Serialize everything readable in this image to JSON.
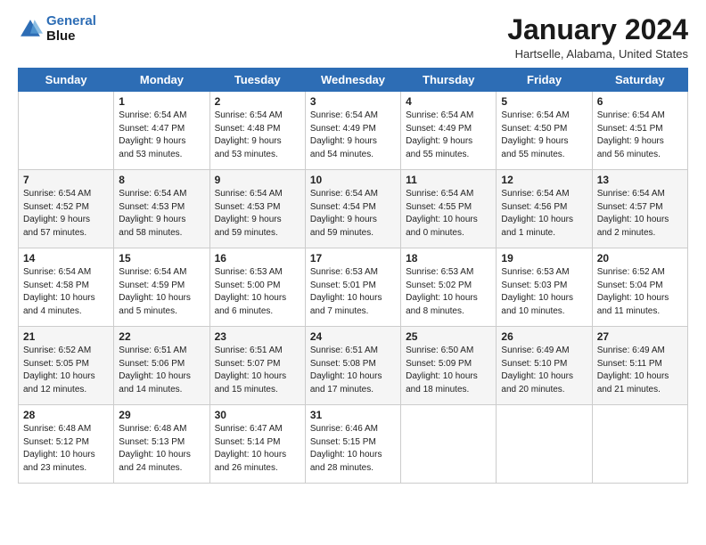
{
  "logo": {
    "line1": "General",
    "line2": "Blue"
  },
  "title": "January 2024",
  "location": "Hartselle, Alabama, United States",
  "headers": [
    "Sunday",
    "Monday",
    "Tuesday",
    "Wednesday",
    "Thursday",
    "Friday",
    "Saturday"
  ],
  "weeks": [
    [
      {
        "day": "",
        "info": ""
      },
      {
        "day": "1",
        "info": "Sunrise: 6:54 AM\nSunset: 4:47 PM\nDaylight: 9 hours\nand 53 minutes."
      },
      {
        "day": "2",
        "info": "Sunrise: 6:54 AM\nSunset: 4:48 PM\nDaylight: 9 hours\nand 53 minutes."
      },
      {
        "day": "3",
        "info": "Sunrise: 6:54 AM\nSunset: 4:49 PM\nDaylight: 9 hours\nand 54 minutes."
      },
      {
        "day": "4",
        "info": "Sunrise: 6:54 AM\nSunset: 4:49 PM\nDaylight: 9 hours\nand 55 minutes."
      },
      {
        "day": "5",
        "info": "Sunrise: 6:54 AM\nSunset: 4:50 PM\nDaylight: 9 hours\nand 55 minutes."
      },
      {
        "day": "6",
        "info": "Sunrise: 6:54 AM\nSunset: 4:51 PM\nDaylight: 9 hours\nand 56 minutes."
      }
    ],
    [
      {
        "day": "7",
        "info": "Sunrise: 6:54 AM\nSunset: 4:52 PM\nDaylight: 9 hours\nand 57 minutes."
      },
      {
        "day": "8",
        "info": "Sunrise: 6:54 AM\nSunset: 4:53 PM\nDaylight: 9 hours\nand 58 minutes."
      },
      {
        "day": "9",
        "info": "Sunrise: 6:54 AM\nSunset: 4:53 PM\nDaylight: 9 hours\nand 59 minutes."
      },
      {
        "day": "10",
        "info": "Sunrise: 6:54 AM\nSunset: 4:54 PM\nDaylight: 9 hours\nand 59 minutes."
      },
      {
        "day": "11",
        "info": "Sunrise: 6:54 AM\nSunset: 4:55 PM\nDaylight: 10 hours\nand 0 minutes."
      },
      {
        "day": "12",
        "info": "Sunrise: 6:54 AM\nSunset: 4:56 PM\nDaylight: 10 hours\nand 1 minute."
      },
      {
        "day": "13",
        "info": "Sunrise: 6:54 AM\nSunset: 4:57 PM\nDaylight: 10 hours\nand 2 minutes."
      }
    ],
    [
      {
        "day": "14",
        "info": "Sunrise: 6:54 AM\nSunset: 4:58 PM\nDaylight: 10 hours\nand 4 minutes."
      },
      {
        "day": "15",
        "info": "Sunrise: 6:54 AM\nSunset: 4:59 PM\nDaylight: 10 hours\nand 5 minutes."
      },
      {
        "day": "16",
        "info": "Sunrise: 6:53 AM\nSunset: 5:00 PM\nDaylight: 10 hours\nand 6 minutes."
      },
      {
        "day": "17",
        "info": "Sunrise: 6:53 AM\nSunset: 5:01 PM\nDaylight: 10 hours\nand 7 minutes."
      },
      {
        "day": "18",
        "info": "Sunrise: 6:53 AM\nSunset: 5:02 PM\nDaylight: 10 hours\nand 8 minutes."
      },
      {
        "day": "19",
        "info": "Sunrise: 6:53 AM\nSunset: 5:03 PM\nDaylight: 10 hours\nand 10 minutes."
      },
      {
        "day": "20",
        "info": "Sunrise: 6:52 AM\nSunset: 5:04 PM\nDaylight: 10 hours\nand 11 minutes."
      }
    ],
    [
      {
        "day": "21",
        "info": "Sunrise: 6:52 AM\nSunset: 5:05 PM\nDaylight: 10 hours\nand 12 minutes."
      },
      {
        "day": "22",
        "info": "Sunrise: 6:51 AM\nSunset: 5:06 PM\nDaylight: 10 hours\nand 14 minutes."
      },
      {
        "day": "23",
        "info": "Sunrise: 6:51 AM\nSunset: 5:07 PM\nDaylight: 10 hours\nand 15 minutes."
      },
      {
        "day": "24",
        "info": "Sunrise: 6:51 AM\nSunset: 5:08 PM\nDaylight: 10 hours\nand 17 minutes."
      },
      {
        "day": "25",
        "info": "Sunrise: 6:50 AM\nSunset: 5:09 PM\nDaylight: 10 hours\nand 18 minutes."
      },
      {
        "day": "26",
        "info": "Sunrise: 6:49 AM\nSunset: 5:10 PM\nDaylight: 10 hours\nand 20 minutes."
      },
      {
        "day": "27",
        "info": "Sunrise: 6:49 AM\nSunset: 5:11 PM\nDaylight: 10 hours\nand 21 minutes."
      }
    ],
    [
      {
        "day": "28",
        "info": "Sunrise: 6:48 AM\nSunset: 5:12 PM\nDaylight: 10 hours\nand 23 minutes."
      },
      {
        "day": "29",
        "info": "Sunrise: 6:48 AM\nSunset: 5:13 PM\nDaylight: 10 hours\nand 24 minutes."
      },
      {
        "day": "30",
        "info": "Sunrise: 6:47 AM\nSunset: 5:14 PM\nDaylight: 10 hours\nand 26 minutes."
      },
      {
        "day": "31",
        "info": "Sunrise: 6:46 AM\nSunset: 5:15 PM\nDaylight: 10 hours\nand 28 minutes."
      },
      {
        "day": "",
        "info": ""
      },
      {
        "day": "",
        "info": ""
      },
      {
        "day": "",
        "info": ""
      }
    ]
  ]
}
